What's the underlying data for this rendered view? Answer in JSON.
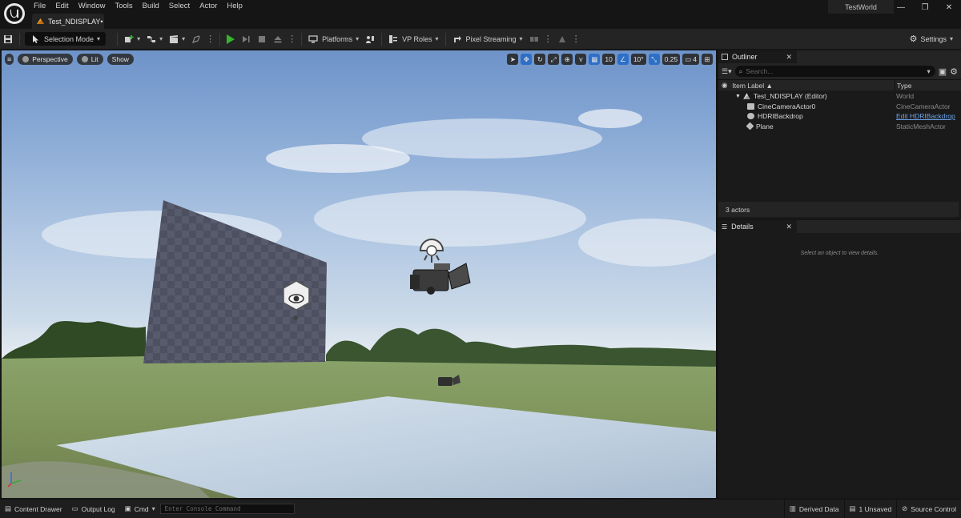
{
  "menu": [
    "File",
    "Edit",
    "Window",
    "Tools",
    "Build",
    "Select",
    "Actor",
    "Help"
  ],
  "document_tab": "Test_NDISPLAY•",
  "world_name": "TestWorld",
  "window_controls": [
    "—",
    "❐",
    "✕"
  ],
  "toolbar": {
    "selection_mode": "Selection Mode",
    "platforms": "Platforms",
    "vp_roles": "VP Roles",
    "pixel_streaming": "Pixel Streaming",
    "settings": "Settings"
  },
  "viewport": {
    "view_mode": "Perspective",
    "lighting": "Lit",
    "show": "Show",
    "grid_snap": "10",
    "rotation_snap": "10°",
    "scale_snap": "0.25",
    "camera_speed": "4"
  },
  "outliner": {
    "tab_label": "Outliner",
    "search_placeholder": "Search...",
    "col_label": "Item Label ▲",
    "col_type": "Type",
    "rows": [
      {
        "label": "Test_NDISPLAY (Editor)",
        "type": "World"
      },
      {
        "label": "CineCameraActor0",
        "type": "CineCameraActor"
      },
      {
        "label": "HDRIBackdrop",
        "type": "Edit HDRIBackdrop"
      },
      {
        "label": "Plane",
        "type": "StaticMeshActor"
      }
    ],
    "actor_count": "3 actors"
  },
  "details": {
    "tab_label": "Details",
    "empty_message": "Select an object to view details."
  },
  "status": {
    "content_drawer": "Content Drawer",
    "output_log": "Output Log",
    "cmd": "Cmd",
    "console_placeholder": "Enter Console Command",
    "derived_data": "Derived Data",
    "unsaved": "1 Unsaved",
    "source_control": "Source Control"
  },
  "colors": {
    "play_green": "#35b52b",
    "accent_blue": "#2d6fc7",
    "link_blue": "#6fa3e8"
  }
}
